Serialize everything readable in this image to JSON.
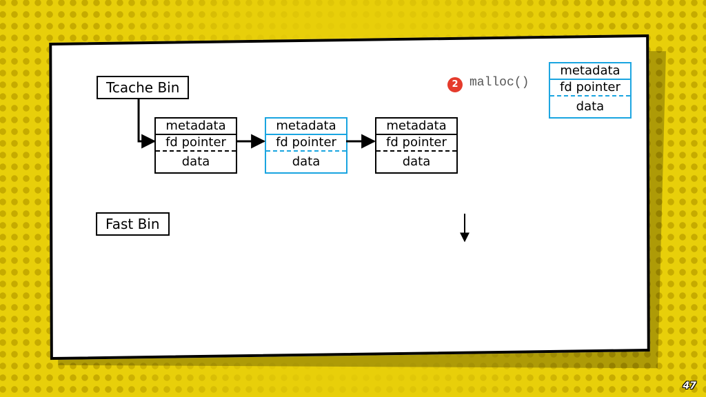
{
  "page_number": "47",
  "labels": {
    "tcache": "Tcache Bin",
    "fast": "Fast Bin"
  },
  "step": {
    "badge": "2",
    "call": "malloc()"
  },
  "chunk_rows": {
    "metadata": "metadata",
    "fd": "fd pointer",
    "data": "data"
  },
  "chunks": [
    {
      "id": "tc0",
      "variant": "k"
    },
    {
      "id": "tc1",
      "variant": "c"
    },
    {
      "id": "tc2",
      "variant": "k"
    },
    {
      "id": "alloc",
      "variant": "c"
    }
  ]
}
